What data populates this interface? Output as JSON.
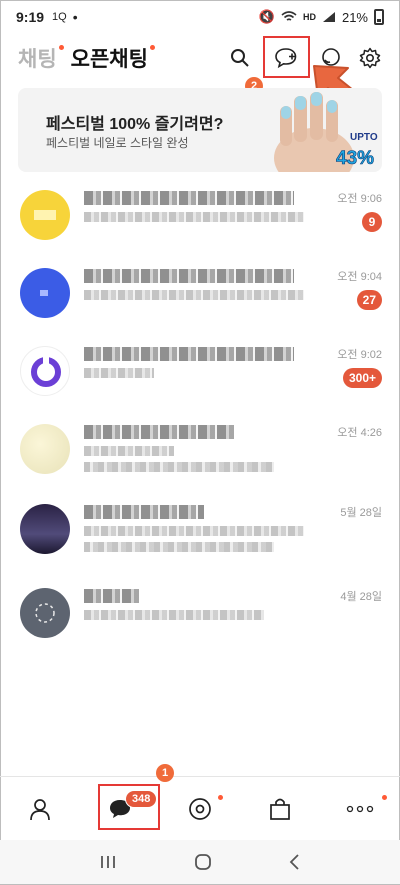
{
  "status_bar": {
    "time": "9:19",
    "icons_left": "1Q",
    "hd_label": "HD",
    "battery": "21%"
  },
  "header": {
    "tab_chat": "채팅",
    "tab_open_chat": "오픈채팅"
  },
  "annotations": {
    "step1": "1",
    "step2": "2"
  },
  "banner": {
    "title": "페스티벌 100% 즐기려면?",
    "subtitle": "페스티벌 네일로 스타일 완성",
    "promo_small": "UPTO",
    "promo_big": "43%"
  },
  "chats": [
    {
      "time": "오전 9:06",
      "badge": "9"
    },
    {
      "time": "오전 9:04",
      "badge": "27"
    },
    {
      "time": "오전 9:02",
      "badge": "300+"
    },
    {
      "time": "오전 4:26",
      "badge": ""
    },
    {
      "time": "5월 28일",
      "badge": ""
    },
    {
      "time": "4월 28일",
      "badge": ""
    }
  ],
  "bottom_nav": {
    "chat_badge": "348"
  },
  "colors": {
    "accent": "#e4583b",
    "highlight": "#e53935",
    "dot": "#ff5a36"
  }
}
